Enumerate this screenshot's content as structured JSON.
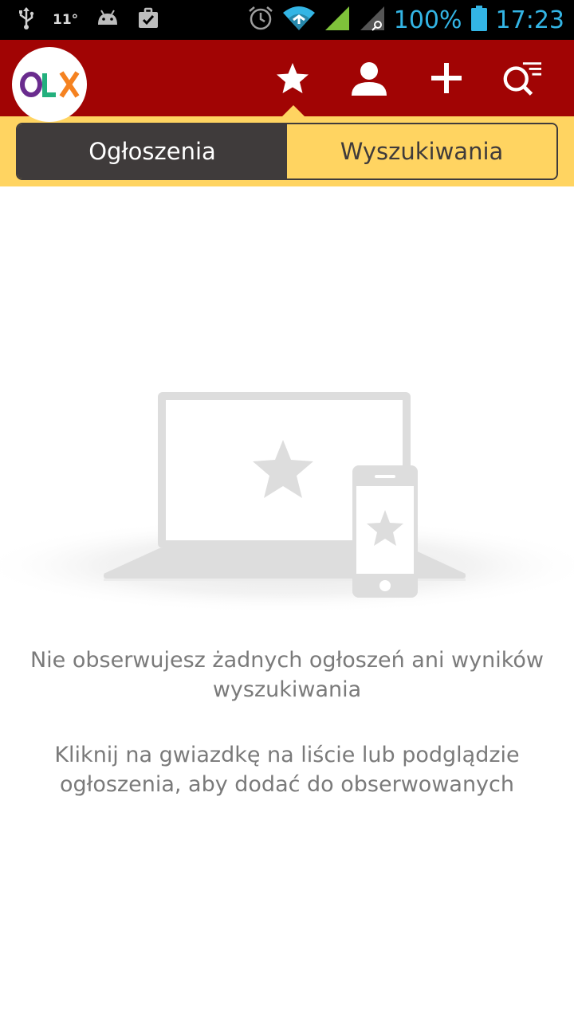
{
  "status_bar": {
    "temperature": "11°",
    "battery_percent": "100%",
    "time": "17:23",
    "icons": [
      "usb-icon",
      "android-icon",
      "briefcase-icon",
      "alarm-icon",
      "wifi-icon",
      "signal-icon",
      "signal-roaming-icon",
      "battery-icon"
    ]
  },
  "app_bar": {
    "logo_text": "OLX",
    "active_nav": "favorites",
    "nav_items": [
      "favorites",
      "profile",
      "add-ad",
      "search-filters"
    ],
    "colors": {
      "bar": "#a10404",
      "tab_strip": "#ffd461",
      "tab_active": "#3f3b3b"
    }
  },
  "tabs": {
    "ads_label": "Ogłoszenia",
    "searches_label": "Wyszukiwania",
    "selected": "ads_label"
  },
  "empty_state": {
    "illustration": "laptop-and-phone-with-star",
    "title_line1": "Nie obserwujesz żadnych ogłoszeń ani wyników",
    "title_line2": "wyszukiwania",
    "hint_line1": "Kliknij na gwiazdkę na liście lub podglądzie",
    "hint_line2": "ogłoszenia, aby dodać do obserwowanych"
  }
}
